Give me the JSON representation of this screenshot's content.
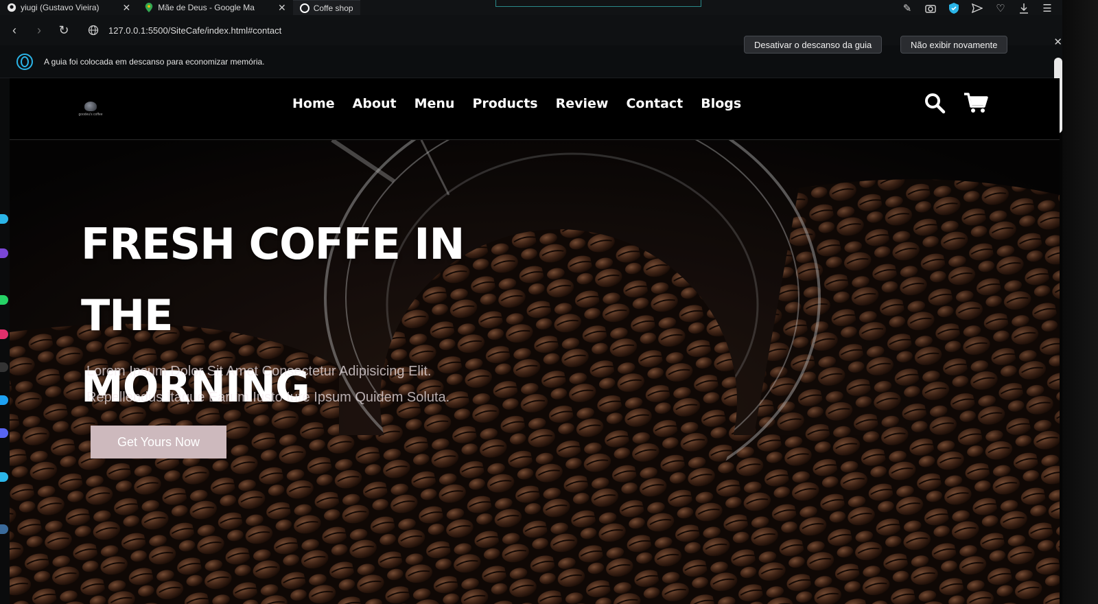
{
  "browser": {
    "tabs": [
      {
        "icon": "github-icon",
        "title": "yiugi (Gustavo Vieira)"
      },
      {
        "icon": "google-maps-icon",
        "title": "Mãe de Deus - Google Ma"
      },
      {
        "icon": "site-icon",
        "title": "Coffe shop"
      }
    ],
    "url": "127.0.0.1:5500/SiteCafe/index.html#contact",
    "infobar": {
      "message": "A guia foi colocada em descanso para economizar memória.",
      "disable_button": "Desativar o descanso da guia",
      "dont_show_button": "Não exibir novamente"
    }
  },
  "site": {
    "logo_text": "goodeu's coffee",
    "menu": [
      "Home",
      "About",
      "Menu",
      "Products",
      "Review",
      "Contact",
      "Blogs"
    ],
    "hero": {
      "title_line1": "FRESH COFFE IN THE",
      "title_line2": "MORNING",
      "subtitle_line1": "Lorem Ipsum Dolor Sit Amet Consectetur Adipisicing Elit.",
      "subtitle_line2": "Repellendus Itaque Earum Iusto Iure Ipsum Quidem Soluta.",
      "cta": "Get Yours Now"
    }
  },
  "colors": {
    "accent": "#2bb5e8",
    "cta_background": "#cdb9bd",
    "header_background": "#000000"
  }
}
